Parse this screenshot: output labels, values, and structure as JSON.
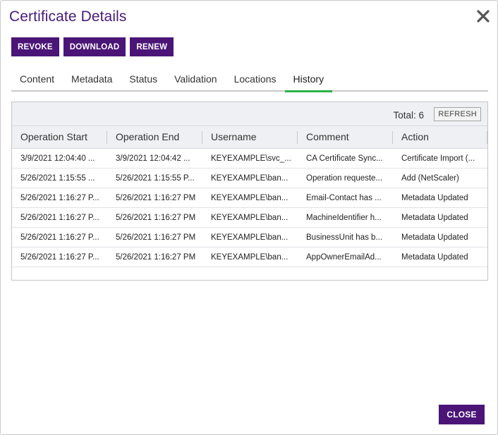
{
  "dialog": {
    "title": "Certificate Details",
    "close_icon": "close-icon"
  },
  "toolbar": {
    "buttons": [
      {
        "label": "REVOKE"
      },
      {
        "label": "DOWNLOAD"
      },
      {
        "label": "RENEW"
      }
    ]
  },
  "tabs": [
    {
      "label": "Content"
    },
    {
      "label": "Metadata"
    },
    {
      "label": "Status"
    },
    {
      "label": "Validation"
    },
    {
      "label": "Locations"
    },
    {
      "label": "History",
      "active": true
    }
  ],
  "history": {
    "total_text": "Total: 6",
    "refresh_label": "REFRESH",
    "columns": [
      "Operation Start",
      "Operation End",
      "Username",
      "Comment",
      "Action"
    ],
    "rows": [
      [
        "3/9/2021 12:04:40 ...",
        "3/9/2021 12:04:42 ...",
        "KEYEXAMPLE\\svc_...",
        "CA Certificate Sync...",
        "Certificate Import (..."
      ],
      [
        "5/26/2021 1:15:55 ...",
        "5/26/2021 1:15:55 P...",
        "KEYEXAMPLE\\ban...",
        "Operation requeste...",
        "Add (NetScaler)"
      ],
      [
        "5/26/2021 1:16:27 P...",
        "5/26/2021 1:16:27 PM",
        "KEYEXAMPLE\\ban...",
        "Email-Contact has ...",
        "Metadata Updated"
      ],
      [
        "5/26/2021 1:16:27 P...",
        "5/26/2021 1:16:27 PM",
        "KEYEXAMPLE\\ban...",
        "MachineIdentifier h...",
        "Metadata Updated"
      ],
      [
        "5/26/2021 1:16:27 P...",
        "5/26/2021 1:16:27 PM",
        "KEYEXAMPLE\\ban...",
        "BusinessUnit has b...",
        "Metadata Updated"
      ],
      [
        "5/26/2021 1:16:27 P...",
        "5/26/2021 1:16:27 PM",
        "KEYEXAMPLE\\ban...",
        "AppOwnerEmailAd...",
        "Metadata Updated"
      ]
    ]
  },
  "footer": {
    "close_label": "CLOSE"
  },
  "colors": {
    "brand": "#4b1577",
    "title": "#4a1a7a",
    "active_tab": "#29b34a"
  }
}
